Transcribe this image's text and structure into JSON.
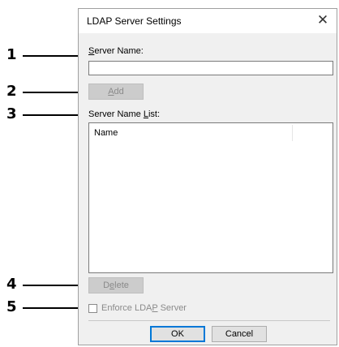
{
  "callouts": [
    "1",
    "2",
    "3",
    "4",
    "5"
  ],
  "dialog": {
    "title": "LDAP Server Settings",
    "close_glyph": "✕"
  },
  "server_name": {
    "label_pre": "",
    "label_mnemonic": "S",
    "label_post": "erver Name:",
    "value": ""
  },
  "add_button": {
    "label_mnemonic": "A",
    "label_post": "dd"
  },
  "server_name_list": {
    "label_pre": "Server Name ",
    "label_mnemonic": "L",
    "label_post": "ist:",
    "column_header": "Name"
  },
  "delete_button": {
    "label_pre": "D",
    "label_mnemonic": "e",
    "label_post": "lete"
  },
  "enforce": {
    "label_pre": "Enforce LDA",
    "label_mnemonic": "P",
    "label_post": " Server",
    "checked": false
  },
  "ok_button": {
    "label": "OK"
  },
  "cancel_button": {
    "label": "Cancel"
  }
}
